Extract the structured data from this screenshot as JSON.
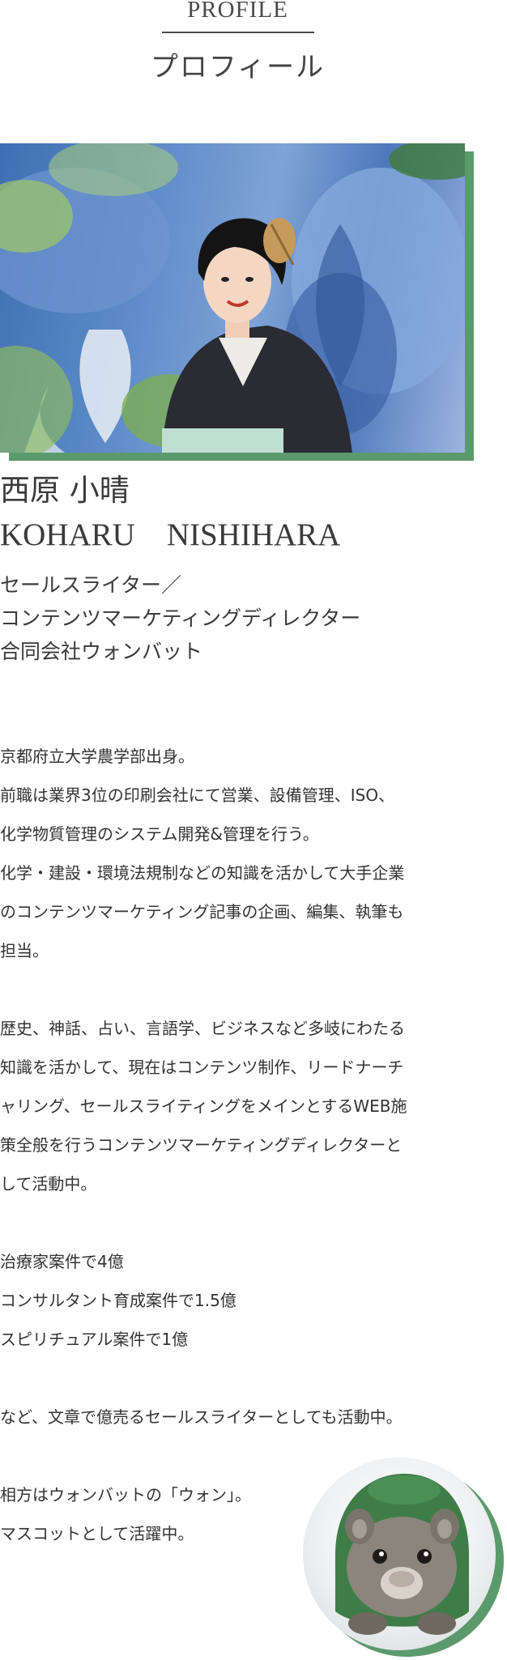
{
  "heading": {
    "en": "PROFILE",
    "ja": "プロフィール"
  },
  "profile": {
    "name_ja": "西原 小晴",
    "name_en": "KOHARU　NISHIHARA",
    "titles": [
      "セールスライター／",
      "コンテンツマーケティングディレクター",
      "合同会社ウォンバット"
    ]
  },
  "bio": {
    "lines": [
      "京都府立大学農学部出身。",
      "前職は業界3位の印刷会社にて営業、設備管理、ISO、",
      "化学物質管理のシステム開発&管理を行う。",
      "化学・建設・環境法規制などの知識を活かして大手企業",
      "のコンテンツマーケティング記事の企画、編集、執筆も",
      "担当。",
      "",
      "歴史、神話、占い、言語学、ビジネスなど多岐にわたる",
      "知識を活かして、現在はコンテンツ制作、リードナーチ",
      "ャリング、セールスライティングをメインとするWEB施",
      "策全般を行うコンテンツマーケティングディレクターと",
      "して活動中。",
      "",
      "治療家案件で4億",
      "コンサルタント育成案件で1.5億",
      "スピリチュアル案件で1億",
      "",
      "など、文章で億売るセールスライターとしても活動中。",
      "",
      "相方はウォンバットの「ウォン」。",
      "マスコットとして活躍中。"
    ]
  },
  "colors": {
    "accent": "#5b9a6c",
    "text": "#333333"
  }
}
